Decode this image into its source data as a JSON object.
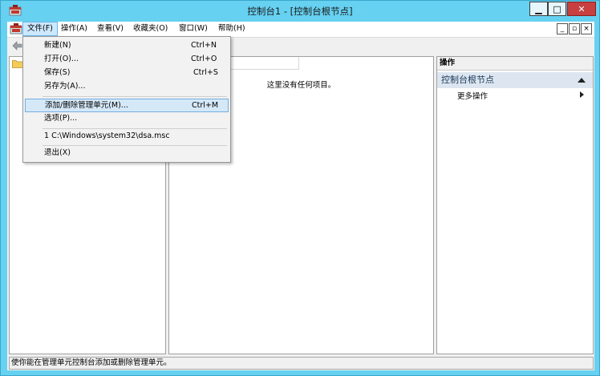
{
  "window": {
    "title": "控制台1 - [控制台根节点]",
    "min_glyph": "▁",
    "max_glyph": "□",
    "close_glyph": "✕"
  },
  "menubar": {
    "items": [
      {
        "label": "文件(F)"
      },
      {
        "label": "操作(A)"
      },
      {
        "label": "查看(V)"
      },
      {
        "label": "收藏夹(O)"
      },
      {
        "label": "窗口(W)"
      },
      {
        "label": "帮助(H)"
      }
    ],
    "mdi_min": "_",
    "mdi_restore": "▫",
    "mdi_close": "×"
  },
  "file_menu": {
    "items": [
      {
        "label": "新建(N)",
        "shortcut": "Ctrl+N"
      },
      {
        "label": "打开(O)...",
        "shortcut": "Ctrl+O"
      },
      {
        "label": "保存(S)",
        "shortcut": "Ctrl+S"
      },
      {
        "label": "另存为(A)..."
      },
      {
        "label": "添加/删除管理单元(M)...",
        "shortcut": "Ctrl+M"
      },
      {
        "label": "选项(P)..."
      },
      {
        "label": "1 C:\\Windows\\system32\\dsa.msc"
      },
      {
        "label": "退出(X)"
      }
    ]
  },
  "center": {
    "empty_text": "这里没有任何项目。"
  },
  "actions": {
    "header": "操作",
    "section_title": "控制台根节点",
    "more_actions": "更多操作"
  },
  "status": {
    "text": "使你能在管理单元控制台添加或删除管理单元。"
  },
  "colors": {
    "title_bar": "#66d1f1",
    "close_button": "#c73f3f",
    "menu_highlight": "#d5e8f8",
    "action_section": "#dde6f0"
  },
  "icons": {
    "app": "mmc-console-icon",
    "back": "back-arrow-icon",
    "tree_root": "folder-icon"
  }
}
